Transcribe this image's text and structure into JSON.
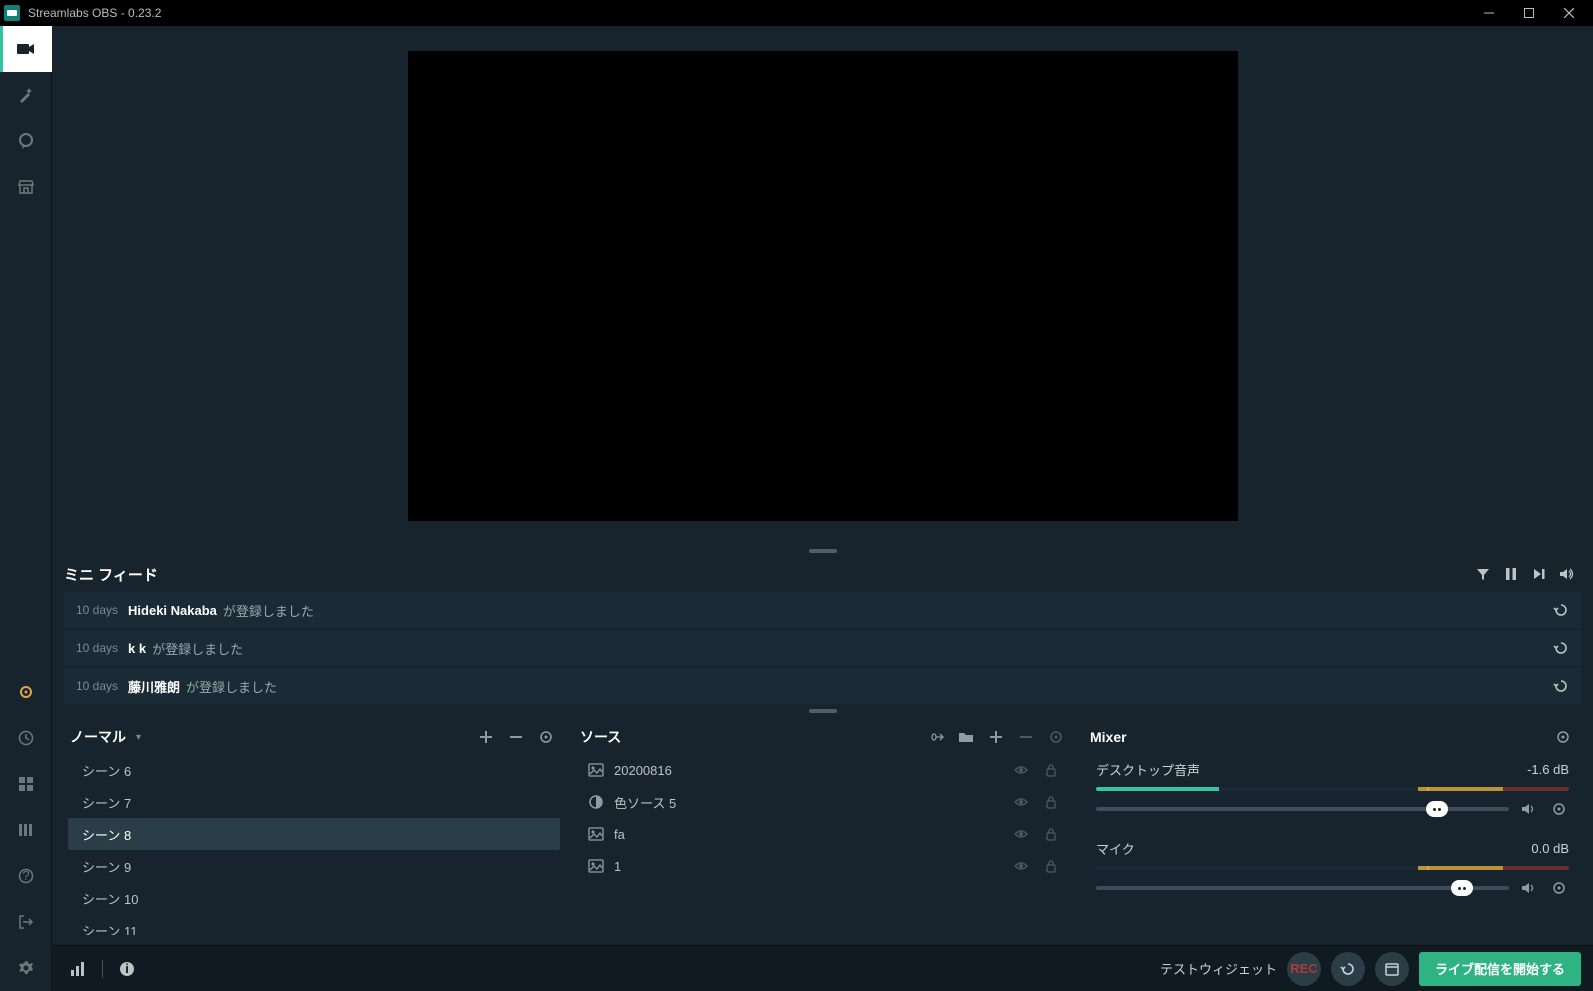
{
  "window": {
    "title": "Streamlabs OBS - 0.23.2"
  },
  "feed": {
    "title": "ミニ フィード",
    "items": [
      {
        "time": "10 days",
        "user": "Hideki Nakaba",
        "action": "が登録しました"
      },
      {
        "time": "10 days",
        "user": "k k",
        "action": "が登録しました"
      },
      {
        "time": "10 days",
        "user": "藤川雅朗",
        "action": "が登録しました"
      }
    ]
  },
  "scenes": {
    "mode": "ノーマル",
    "items": [
      {
        "label": "シーン 6",
        "selected": false
      },
      {
        "label": "シーン 7",
        "selected": false
      },
      {
        "label": "シーン 8",
        "selected": true
      },
      {
        "label": "シーン 9",
        "selected": false
      },
      {
        "label": "シーン 10",
        "selected": false
      },
      {
        "label": "シーン 11",
        "selected": false
      }
    ]
  },
  "sources": {
    "title": "ソース",
    "items": [
      {
        "icon": "image",
        "label": "20200816"
      },
      {
        "icon": "color",
        "label": "色ソース 5"
      },
      {
        "icon": "image",
        "label": "fa"
      },
      {
        "icon": "image",
        "label": "1"
      }
    ]
  },
  "mixer": {
    "title": "Mixer",
    "channels": [
      {
        "name": "デスクトップ音声",
        "level": "-1.6 dB",
        "fill": 26,
        "thumb": 80
      },
      {
        "name": "マイク",
        "level": "0.0 dB",
        "fill": 0,
        "thumb": 86
      }
    ]
  },
  "footer": {
    "test_widget": "テストウィジェット",
    "rec": "REC",
    "golive": "ライブ配信を開始する"
  }
}
